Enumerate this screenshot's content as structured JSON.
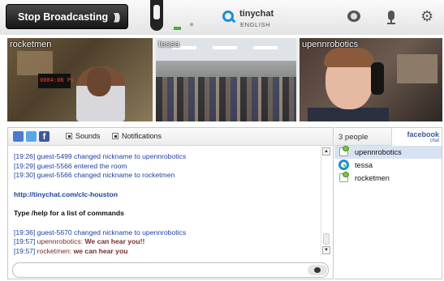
{
  "topbar": {
    "broadcast_label": "Stop Broadcasting",
    "broadcast_icon": "((",
    "brand": "tinychat",
    "language": "ENGLISH",
    "icons": [
      "webcam-icon",
      "microphone-icon",
      "gear-icon"
    ]
  },
  "videos": [
    {
      "name": "rocketmen",
      "sign_text": "0004:08 Ps"
    },
    {
      "name": "tessa"
    },
    {
      "name": "upennrobotics"
    }
  ],
  "chat": {
    "toolbar": {
      "facebook_glyph": "f",
      "sounds_label": "Sounds",
      "notifications_label": "Notifications"
    },
    "messages": [
      {
        "type": "sys",
        "text": "[19:26] guest-5499 changed nickname to upennrobotics"
      },
      {
        "type": "sys",
        "text": "[19:29] guest-5566 entered the room"
      },
      {
        "type": "sys",
        "text": "[19:30] guest-5566 changed nickname to rocketmen"
      },
      {
        "type": "link",
        "text": "http://tinychat.com/clc-houston"
      },
      {
        "type": "help",
        "text": "Type /help for a list of commands"
      },
      {
        "type": "sys",
        "text": "[19:36] guest-5670 changed nickname to upennrobotics"
      },
      {
        "type": "chat",
        "time": "[19:57]",
        "nick": "upennrobotics:",
        "text": "We can hear you!!"
      },
      {
        "type": "chat",
        "time": "[19:57]",
        "nick": "rocketmen:",
        "text": "we can hear you"
      }
    ],
    "input_placeholder": ""
  },
  "people": {
    "count_label": "3 people",
    "facebook_label": "facebook",
    "facebook_sub": "chat",
    "list": [
      {
        "name": "upennrobotics",
        "icon": "user-avatar-icon",
        "selected": true
      },
      {
        "name": "tessa",
        "icon": "tinychat-logo-icon",
        "selected": false
      },
      {
        "name": "rocketmen",
        "icon": "user-avatar-icon",
        "selected": false
      }
    ]
  },
  "colors": {
    "accent_blue": "#1a8ed8",
    "message_blue": "#1d3fa0",
    "nick_red": "#7a2b2b",
    "level_green": "#3cb72e"
  }
}
